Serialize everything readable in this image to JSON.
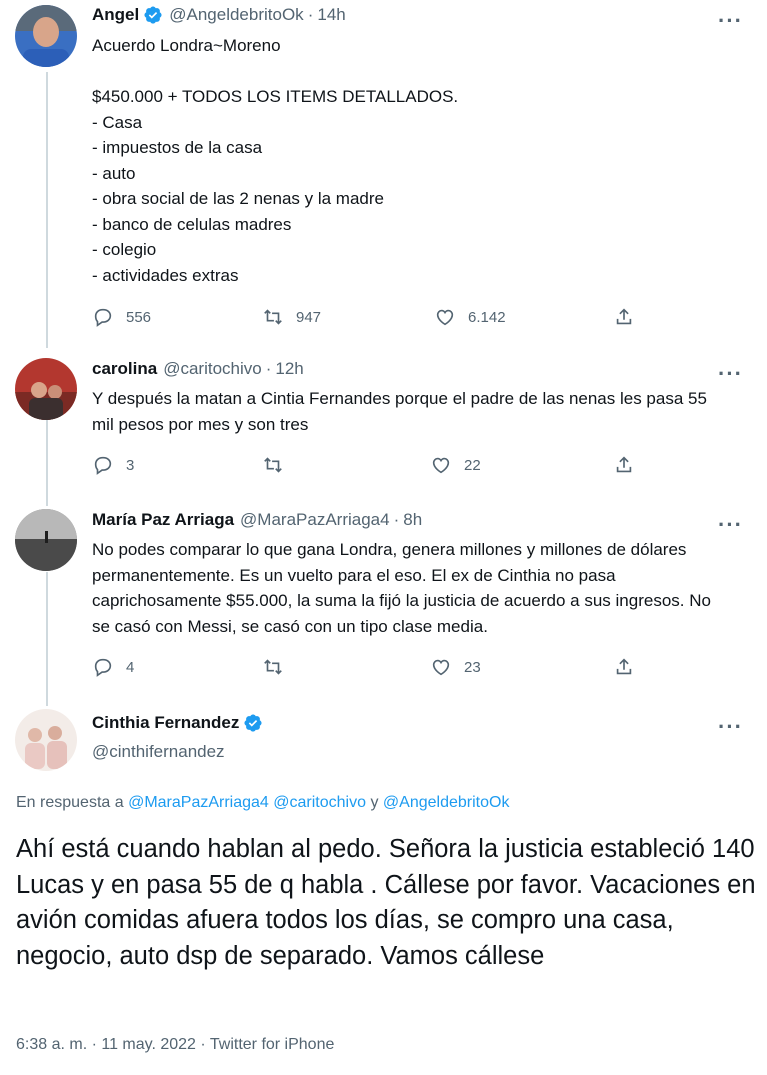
{
  "tweets": [
    {
      "name": "Angel",
      "verified": true,
      "handle": "@AngeldebritoOk",
      "dot": "·",
      "time": "14h",
      "text": "Acuerdo Londra~Moreno\n\n$450.000 + TODOS LOS ITEMS DETALLADOS.\n- Casa\n- impuestos de la casa\n- auto\n- obra social de las 2 nenas y la madre\n- banco de celulas madres\n- colegio\n- actividades extras",
      "replies": "556",
      "retweets": "947",
      "likes": "6.142"
    },
    {
      "name": "carolina",
      "handle": "@caritochivo",
      "dot": "·",
      "time": "12h",
      "text": "Y después la matan a Cintia Fernandes porque el padre de las nenas les pasa 55 mil pesos por mes y son tres",
      "replies": "3",
      "retweets": "",
      "likes": "22"
    },
    {
      "name": "María Paz Arriaga",
      "handle": "@MaraPazArriaga4",
      "dot": "·",
      "time": "8h",
      "text": "No podes comparar lo que gana Londra, genera millones y millones de dólares permanentemente. Es un vuelto para el eso. El ex de Cinthia no pasa caprichosamente $55.000, la suma la fijó la justicia de acuerdo a sus ingresos. No se casó con Messi, se casó con un tipo clase media.",
      "replies": "4",
      "retweets": "",
      "likes": "23"
    }
  ],
  "main_tweet": {
    "name": "Cinthia Fernandez",
    "verified": true,
    "handle": "@cinthifernandez",
    "reply_prefix": "En respuesta a",
    "mention_1": "@MaraPazArriaga4",
    "mention_2": "@caritochivo",
    "reply_y": "y",
    "mention_3": "@AngeldebritoOk",
    "text": "Ahí está cuando hablan al pedo. Señora la justicia estableció 140 Lucas y en pasa 55 de q habla . Cállese por favor. Vacaciones en avión comidas afuera todos los días, se compro una casa, negocio, auto dsp de separado. Vamos cállese",
    "meta": "6:38 a. m. · 11 may. 2022 · Twitter for iPhone"
  },
  "more_label": "···",
  "colors": {
    "accent": "#1d9bf0",
    "secondary": "#536471",
    "thread": "#cfd9de"
  }
}
